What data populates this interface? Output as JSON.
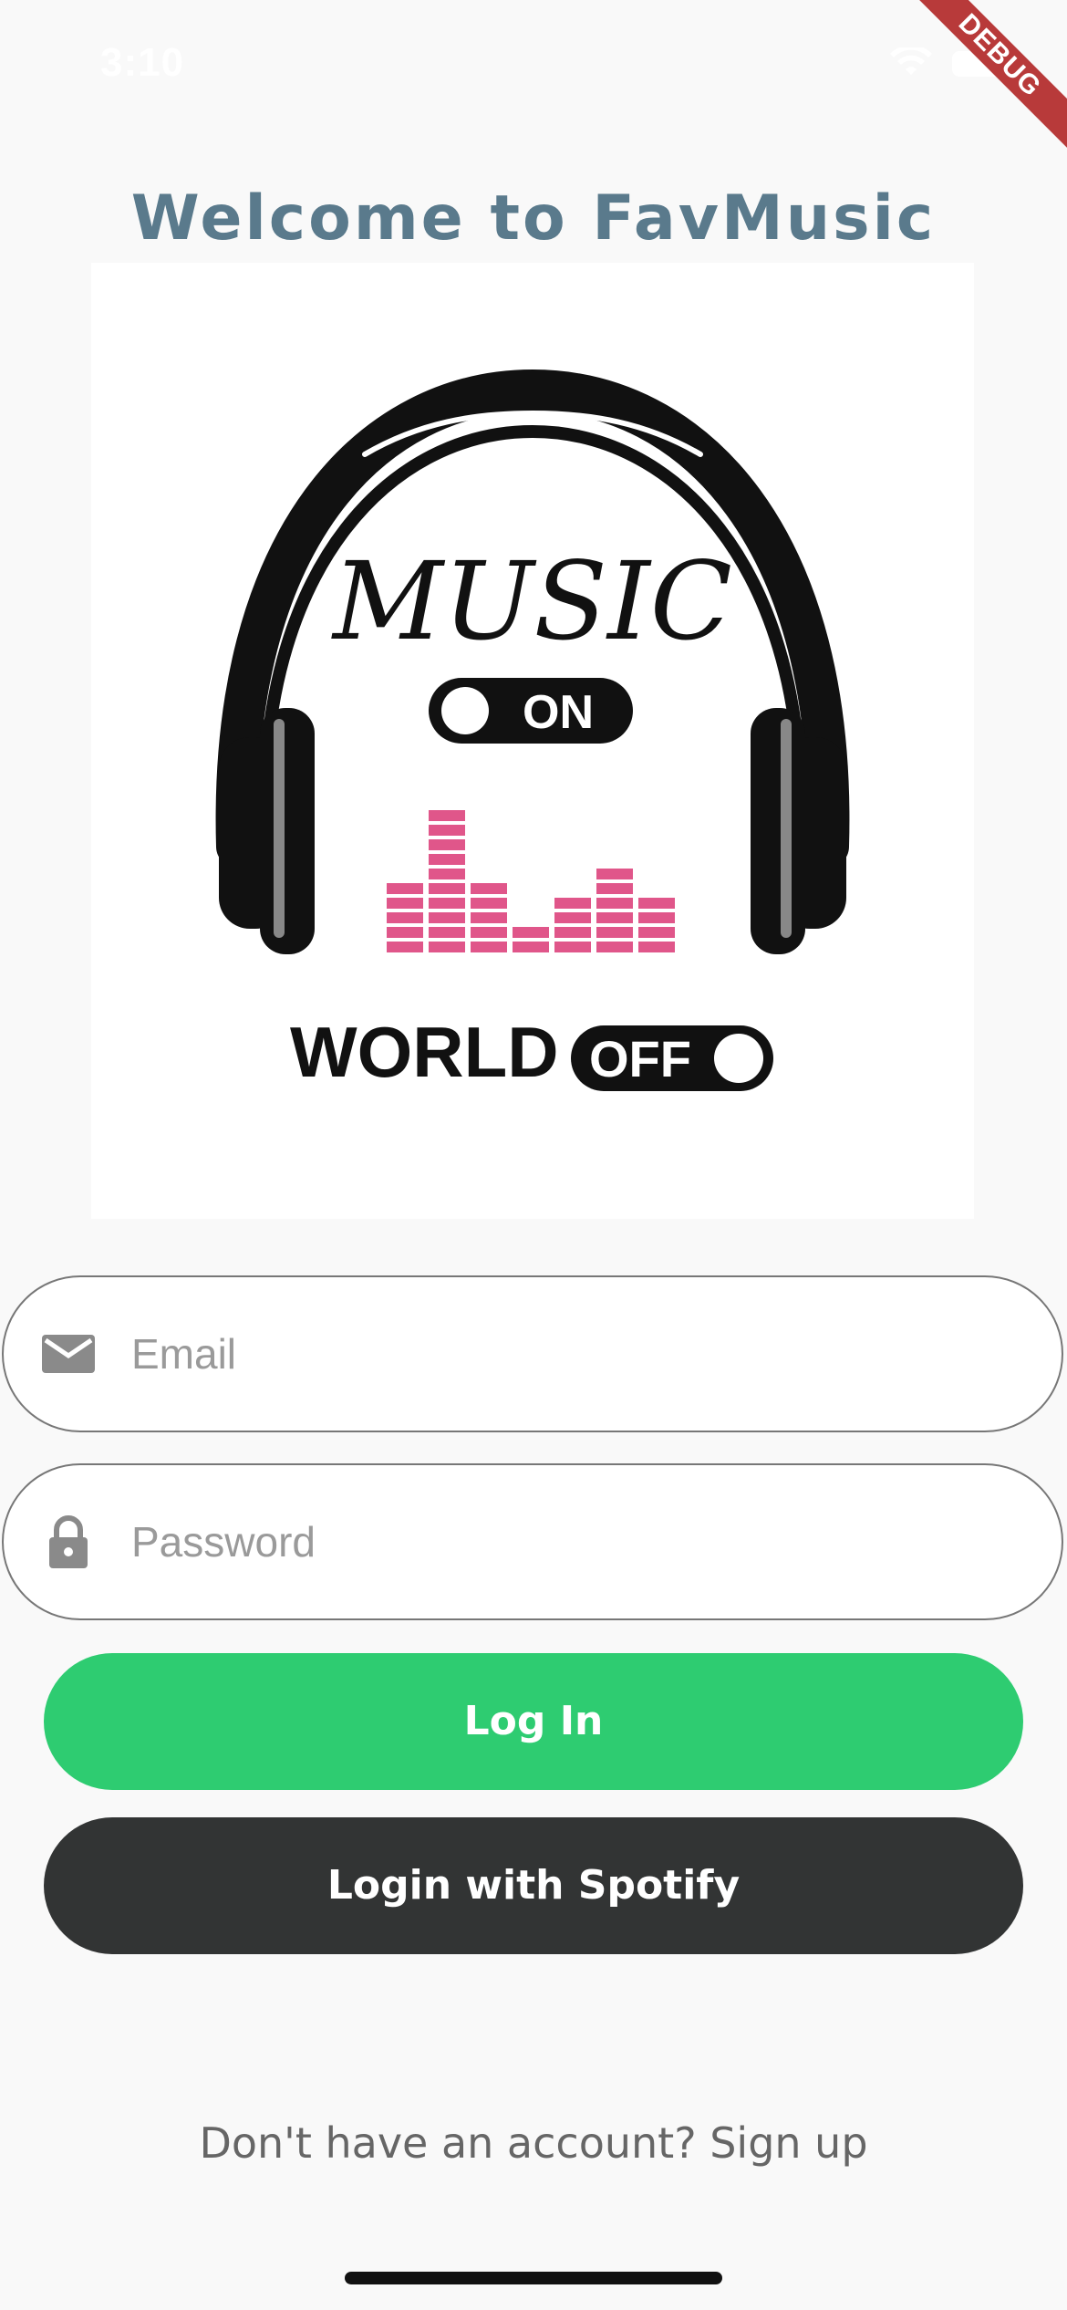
{
  "status_bar": {
    "time": "3:10",
    "wifi_icon": "wifi-icon",
    "battery_icon": "battery-icon"
  },
  "debug_banner": {
    "label": "DEBUG"
  },
  "header": {
    "title": "Welcome to FavMusic"
  },
  "logo": {
    "text_top": "MUSIC",
    "toggle_on_label": "ON",
    "text_bottom": "WORLD",
    "toggle_off_label": "OFF",
    "accent_color": "#e0568a"
  },
  "form": {
    "email": {
      "placeholder": "Email",
      "value": "",
      "icon": "mail-icon"
    },
    "password": {
      "placeholder": "Password",
      "value": "",
      "icon": "lock-icon"
    }
  },
  "buttons": {
    "login_label": "Log In",
    "login_color": "#2ecc71",
    "spotify_label": "Login with Spotify",
    "spotify_color": "#323434"
  },
  "footer": {
    "signup_text": "Don't have an account? Sign up"
  }
}
